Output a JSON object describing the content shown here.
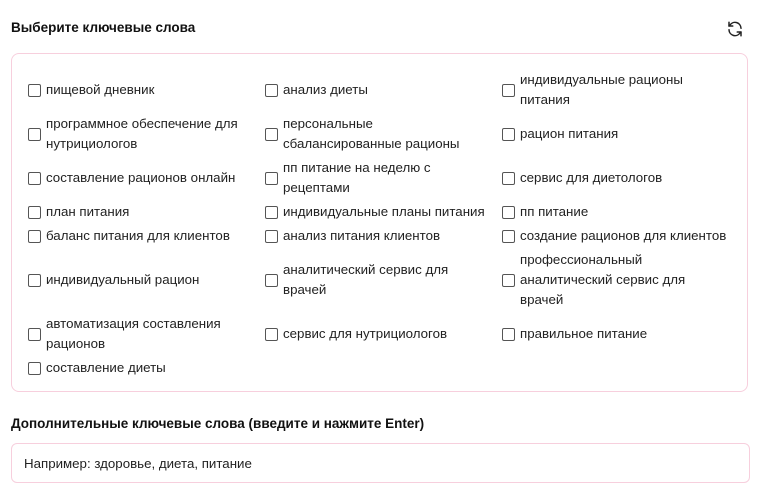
{
  "section": {
    "title": "Выберите ключевые слова",
    "refresh_icon": "refresh-icon"
  },
  "keywords": [
    "пищевой дневник",
    "анализ диеты",
    "индивидуальные рационы\nпитания",
    "программное обеспечение для\nнутрициологов",
    "персональные\nсбалансированные рационы",
    "рацион питания",
    "составление рационов онлайн",
    "пп питание на неделю с\nрецептами",
    "сервис для диетологов",
    "план питания",
    "индивидуальные планы питания",
    "пп питание",
    "баланс питания для клиентов",
    "анализ питания клиентов",
    "создание рационов для клиентов",
    "индивидуальный рацион",
    "аналитический сервис для\nврачей",
    "профессиональный\nаналитический сервис для\nврачей",
    "автоматизация составления\nрационов",
    "сервис для нутрициологов",
    "правильное питание",
    "составление диеты"
  ],
  "extra": {
    "title": "Дополнительные ключевые слова (введите и нажмите Enter)",
    "placeholder": "Например: здоровье, диета, питание"
  },
  "colors": {
    "border": "#f7cfdd"
  }
}
